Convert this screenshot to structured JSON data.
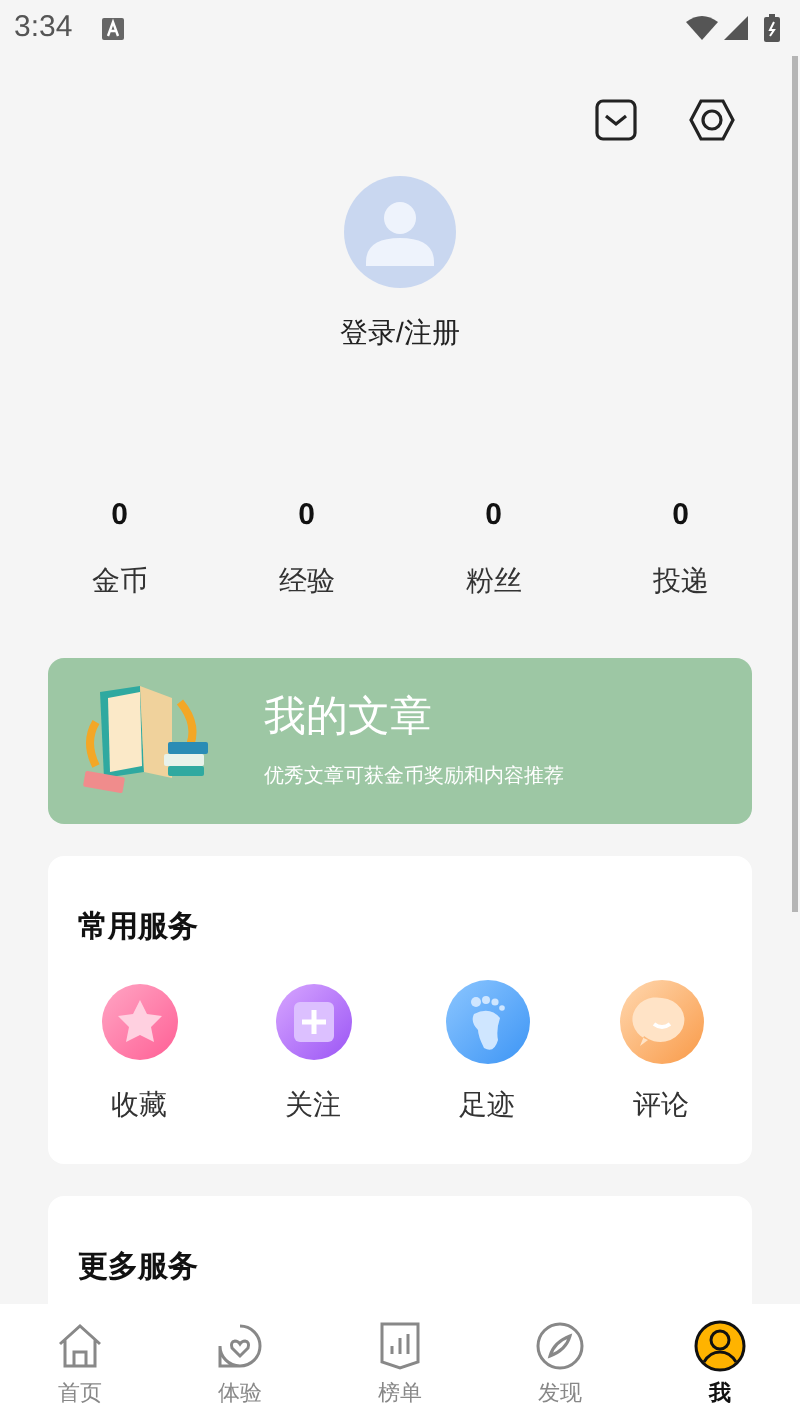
{
  "status_bar": {
    "time": "3:34"
  },
  "header": {
    "login": "登录/注册"
  },
  "stats": [
    {
      "value": "0",
      "label": "金币"
    },
    {
      "value": "0",
      "label": "经验"
    },
    {
      "value": "0",
      "label": "粉丝"
    },
    {
      "value": "0",
      "label": "投递"
    }
  ],
  "banner": {
    "title": "我的文章",
    "subtitle": "优秀文章可获金币奖励和内容推荐"
  },
  "common_services": {
    "title": "常用服务",
    "items": [
      {
        "label": "收藏",
        "kind": "star"
      },
      {
        "label": "关注",
        "kind": "plus"
      },
      {
        "label": "足迹",
        "kind": "foot"
      },
      {
        "label": "评论",
        "kind": "chat"
      }
    ]
  },
  "more_services": {
    "title": "更多服务"
  },
  "tab_bar": [
    {
      "label": "首页",
      "kind": "home",
      "selected": false
    },
    {
      "label": "体验",
      "kind": "heart",
      "selected": false
    },
    {
      "label": "榜单",
      "kind": "chart",
      "selected": false
    },
    {
      "label": "发现",
      "kind": "compass",
      "selected": false
    },
    {
      "label": "我",
      "kind": "user",
      "selected": true
    }
  ]
}
